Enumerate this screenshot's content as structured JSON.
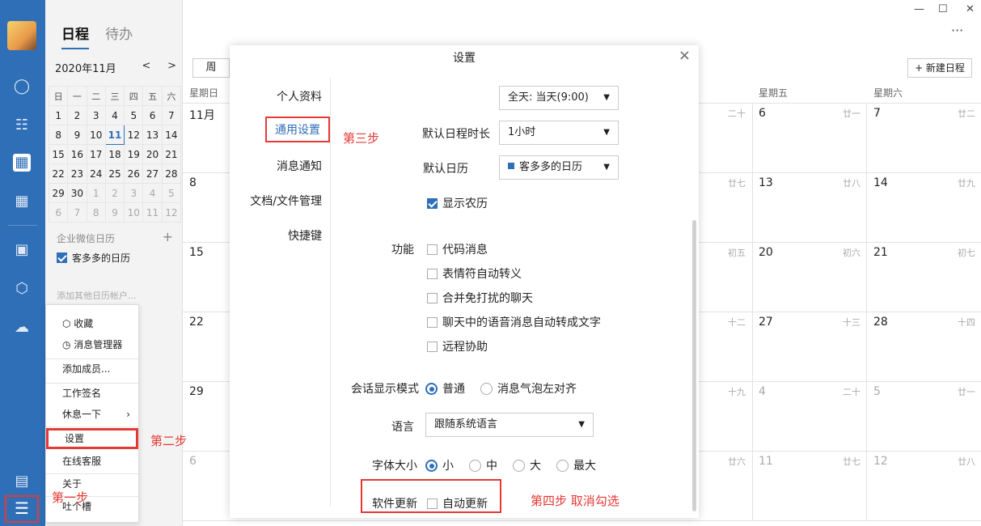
{
  "tabs": {
    "schedule": "日程",
    "todo": "待办"
  },
  "mini_calendar": {
    "month_label": "2020年11月",
    "prev": "<",
    "next": ">",
    "weekdays": [
      "日",
      "一",
      "二",
      "三",
      "四",
      "五",
      "六"
    ],
    "weeks": [
      [
        "1",
        "2",
        "3",
        "4",
        "5",
        "6",
        "7"
      ],
      [
        "8",
        "9",
        "10",
        "11",
        "12",
        "13",
        "14"
      ],
      [
        "15",
        "16",
        "17",
        "18",
        "19",
        "20",
        "21"
      ],
      [
        "22",
        "23",
        "24",
        "25",
        "26",
        "27",
        "28"
      ],
      [
        "29",
        "30",
        "1",
        "2",
        "3",
        "4",
        "5"
      ],
      [
        "6",
        "7",
        "8",
        "9",
        "10",
        "11",
        "12"
      ]
    ],
    "today": "11"
  },
  "calendars": {
    "section_title": "企业微信日历",
    "add_icon": "+",
    "entry": "客多多的日历",
    "add_other": "添加其他日历帐户..."
  },
  "menu": {
    "favorite": "收藏",
    "message_manager": "消息管理器",
    "add_member": "添加成员...",
    "work_signature": "工作签名",
    "rest": "休息一下",
    "settings": "设置",
    "online_service": "在线客服",
    "about": "关于",
    "feedback": "吐个槽"
  },
  "steps": {
    "step1": "第一步",
    "step2": "第二步",
    "step3": "第三步",
    "step4": "第四步 取消勾选"
  },
  "main": {
    "week_button": "周",
    "new_event": "+ 新建日程",
    "col_sun": "星期日",
    "col_fri": "星期五",
    "col_sat": "星期六",
    "month_label": "11月",
    "rows": [
      {
        "sun": "",
        "mid_lunar": "二十",
        "fri": "6",
        "fri_lunar": "廿一",
        "sat": "7",
        "sat_lunar": "廿二"
      },
      {
        "sun": "8",
        "mid_lunar": "廿七",
        "fri": "13",
        "fri_lunar": "廿八",
        "sat": "14",
        "sat_lunar": "廿九"
      },
      {
        "sun": "15",
        "mid_lunar": "初五",
        "fri": "20",
        "fri_lunar": "初六",
        "sat": "21",
        "sat_lunar": "初七"
      },
      {
        "sun": "22",
        "mid_lunar": "十二",
        "fri": "27",
        "fri_lunar": "十三",
        "sat": "28",
        "sat_lunar": "十四"
      },
      {
        "sun": "29",
        "mid_lunar": "十九",
        "fri": "4",
        "fri_lunar": "二十",
        "sat": "5",
        "sat_lunar": "廿一"
      },
      {
        "sun": "6",
        "mid_lunar": "廿六",
        "fri": "11",
        "fri_lunar": "廿七",
        "sat": "12",
        "sat_lunar": "廿八"
      }
    ],
    "window": {
      "minimize": "—",
      "maximize": "☐",
      "close": "✕",
      "more": "···"
    }
  },
  "settings": {
    "title": "设置",
    "close": "×",
    "nav": {
      "profile": "个人资料",
      "general": "通用设置",
      "notifications": "消息通知",
      "files": "文档/文件管理",
      "shortcuts": "快捷键"
    },
    "allday_value": "全天: 当天(9:00)",
    "duration_label": "默认日程时长",
    "duration_value": "1小时",
    "default_cal_label": "默认日历",
    "default_cal_value": "客多多的日历",
    "show_lunar": "显示农历",
    "features_label": "功能",
    "features": [
      "代码消息",
      "表情符自动转义",
      "合并免打扰的聊天",
      "聊天中的语音消息自动转成文字",
      "远程协助"
    ],
    "display_mode_label": "会话显示模式",
    "display_normal": "普通",
    "display_left": "消息气泡左对齐",
    "language_label": "语言",
    "language_value": "跟随系统语言",
    "font_size_label": "字体大小",
    "font_small": "小",
    "font_medium": "中",
    "font_large": "大",
    "font_max": "最大",
    "update_label": "软件更新",
    "auto_update": "自动更新"
  },
  "colors": {
    "accent": "#2f6fb8",
    "highlight": "#e53935"
  }
}
